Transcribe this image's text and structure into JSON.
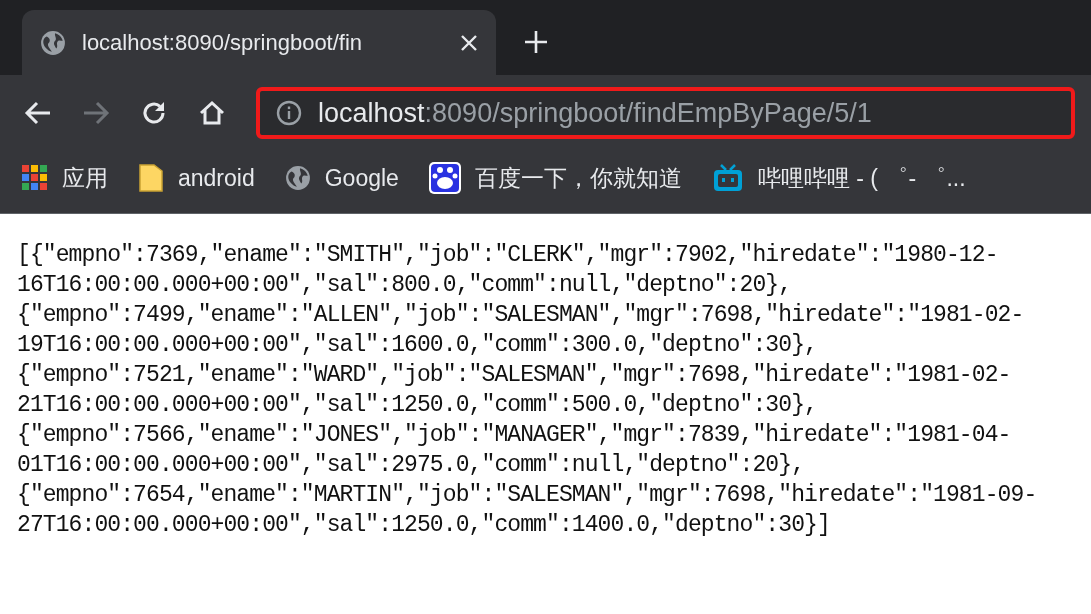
{
  "tab": {
    "title": "localhost:8090/springboot/fin",
    "selected": true
  },
  "toolbar": {
    "url_host": "localhost",
    "url_path": ":8090/springboot/findEmpByPage/5/1",
    "highlighted": true,
    "forward_disabled": true
  },
  "bookmarks": [
    {
      "kind": "apps",
      "label": "应用"
    },
    {
      "kind": "folder",
      "label": "android"
    },
    {
      "kind": "globe",
      "label": "Google"
    },
    {
      "kind": "paw",
      "label": "百度一下，你就知道"
    },
    {
      "kind": "tv",
      "label": "哔哩哔哩 - ( ゜- ゜..."
    }
  ],
  "content_lines": [
    "[{\"empno\":7369,\"ename\":\"SMITH\",\"job\":\"CLERK\",\"mgr\":7902,\"hiredate\":\"1980-12-",
    "16T16:00:00.000+00:00\",\"sal\":800.0,\"comm\":null,\"deptno\":20},",
    "{\"empno\":7499,\"ename\":\"ALLEN\",\"job\":\"SALESMAN\",\"mgr\":7698,\"hiredate\":\"1981-02-",
    "19T16:00:00.000+00:00\",\"sal\":1600.0,\"comm\":300.0,\"deptno\":30},",
    "{\"empno\":7521,\"ename\":\"WARD\",\"job\":\"SALESMAN\",\"mgr\":7698,\"hiredate\":\"1981-02-",
    "21T16:00:00.000+00:00\",\"sal\":1250.0,\"comm\":500.0,\"deptno\":30},",
    "{\"empno\":7566,\"ename\":\"JONES\",\"job\":\"MANAGER\",\"mgr\":7839,\"hiredate\":\"1981-04-",
    "01T16:00:00.000+00:00\",\"sal\":2975.0,\"comm\":null,\"deptno\":20},",
    "{\"empno\":7654,\"ename\":\"MARTIN\",\"job\":\"SALESMAN\",\"mgr\":7698,\"hiredate\":\"1981-09-",
    "27T16:00:00.000+00:00\",\"sal\":1250.0,\"comm\":1400.0,\"deptno\":30}]"
  ]
}
